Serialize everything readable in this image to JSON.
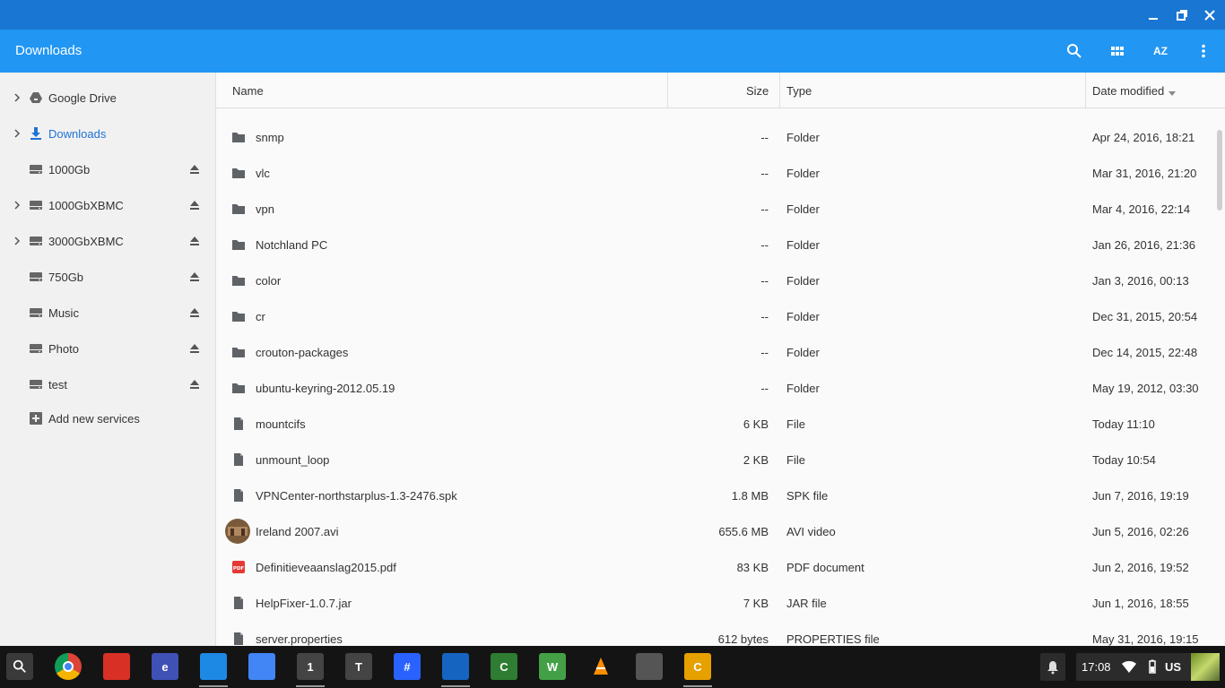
{
  "window": {
    "controls": [
      "minimize-icon",
      "restore-icon",
      "close-icon"
    ]
  },
  "header": {
    "title": "Downloads",
    "sort_label": "AZ",
    "actions": [
      "search-icon",
      "grid-view-icon",
      "sort-icon",
      "more-icon"
    ]
  },
  "sidebar": {
    "items": [
      {
        "label": "Google Drive",
        "icon": "drive-icon",
        "expandable": true,
        "eject": false
      },
      {
        "label": "Downloads",
        "icon": "download-icon",
        "expandable": true,
        "eject": false,
        "active": true
      },
      {
        "label": "1000Gb",
        "icon": "drive-disk-icon",
        "expandable": false,
        "eject": true
      },
      {
        "label": "1000GbXBMC",
        "icon": "drive-disk-icon",
        "expandable": true,
        "eject": true
      },
      {
        "label": "3000GbXBMC",
        "icon": "drive-disk-icon",
        "expandable": true,
        "eject": true
      },
      {
        "label": "750Gb",
        "icon": "drive-disk-icon",
        "expandable": false,
        "eject": true
      },
      {
        "label": "Music",
        "icon": "drive-disk-icon",
        "expandable": false,
        "eject": true
      },
      {
        "label": "Photo",
        "icon": "drive-disk-icon",
        "expandable": false,
        "eject": true
      },
      {
        "label": "test",
        "icon": "drive-disk-icon",
        "expandable": false,
        "eject": true
      }
    ],
    "add_services": "Add new services"
  },
  "columns": {
    "name": "Name",
    "size": "Size",
    "type": "Type",
    "date": "Date modified"
  },
  "files": [
    {
      "name": "snmp",
      "size": "--",
      "type": "Folder",
      "date": "Apr 24, 2016, 18:21",
      "icon": "folder-icon"
    },
    {
      "name": "vlc",
      "size": "--",
      "type": "Folder",
      "date": "Mar 31, 2016, 21:20",
      "icon": "folder-icon"
    },
    {
      "name": "vpn",
      "size": "--",
      "type": "Folder",
      "date": "Mar 4, 2016, 22:14",
      "icon": "folder-icon"
    },
    {
      "name": "Notchland PC",
      "size": "--",
      "type": "Folder",
      "date": "Jan 26, 2016, 21:36",
      "icon": "folder-icon"
    },
    {
      "name": "color",
      "size": "--",
      "type": "Folder",
      "date": "Jan 3, 2016, 00:13",
      "icon": "folder-icon"
    },
    {
      "name": "cr",
      "size": "--",
      "type": "Folder",
      "date": "Dec 31, 2015, 20:54",
      "icon": "folder-icon"
    },
    {
      "name": "crouton-packages",
      "size": "--",
      "type": "Folder",
      "date": "Dec 14, 2015, 22:48",
      "icon": "folder-icon"
    },
    {
      "name": "ubuntu-keyring-2012.05.19",
      "size": "--",
      "type": "Folder",
      "date": "May 19, 2012, 03:30",
      "icon": "folder-icon"
    },
    {
      "name": "mountcifs",
      "size": "6 KB",
      "type": "File",
      "date": "Today 11:10",
      "icon": "file-icon"
    },
    {
      "name": "unmount_loop",
      "size": "2 KB",
      "type": "File",
      "date": "Today 10:54",
      "icon": "file-icon"
    },
    {
      "name": "VPNCenter-northstarplus-1.3-2476.spk",
      "size": "1.8 MB",
      "type": "SPK file",
      "date": "Jun 7, 2016, 19:19",
      "icon": "file-icon"
    },
    {
      "name": "Ireland 2007.avi",
      "size": "655.6 MB",
      "type": "AVI video",
      "date": "Jun 5, 2016, 02:26",
      "icon": "video-thumbnail-icon"
    },
    {
      "name": "Definitieveaanslag2015.pdf",
      "size": "83 KB",
      "type": "PDF document",
      "date": "Jun 2, 2016, 19:52",
      "icon": "pdf-icon"
    },
    {
      "name": "HelpFixer-1.0.7.jar",
      "size": "7 KB",
      "type": "JAR file",
      "date": "Jun 1, 2016, 18:55",
      "icon": "file-icon"
    },
    {
      "name": "server.properties",
      "size": "612 bytes",
      "type": "PROPERTIES file",
      "date": "May 31, 2016, 19:15",
      "icon": "file-icon"
    }
  ],
  "shelf": {
    "apps": [
      {
        "name": "chrome",
        "icon": "chrome-icon",
        "color": "#4caf50",
        "glyph": ""
      },
      {
        "name": "gmail",
        "icon": "gmail-icon",
        "color": "#d93025",
        "glyph": ""
      },
      {
        "name": "text-editor",
        "icon": "editor-icon",
        "color": "#3f51b5",
        "glyph": "e"
      },
      {
        "name": "files",
        "icon": "files-icon",
        "color": "#1e88e5",
        "glyph": "",
        "open": true
      },
      {
        "name": "docs",
        "icon": "docs-icon",
        "color": "#4285f4",
        "glyph": ""
      },
      {
        "name": "terminal-1",
        "icon": "terminal-icon",
        "color": "#444444",
        "glyph": "1",
        "open": true
      },
      {
        "name": "terminal-t",
        "icon": "terminal-icon",
        "color": "#444444",
        "glyph": "T"
      },
      {
        "name": "hashtag-chat",
        "icon": "chat-icon",
        "color": "#2962ff",
        "glyph": "#"
      },
      {
        "name": "bird-app",
        "icon": "bird-icon",
        "color": "#1565c0",
        "glyph": "",
        "open": true
      },
      {
        "name": "crosh",
        "icon": "crosh-icon",
        "color": "#2e7d32",
        "glyph": "C"
      },
      {
        "name": "writer",
        "icon": "writer-icon",
        "color": "#43a047",
        "glyph": "W"
      },
      {
        "name": "vlc",
        "icon": "vlc-icon",
        "color": "#ff8f00",
        "glyph": ""
      },
      {
        "name": "webcam",
        "icon": "webcam-icon",
        "color": "#555555",
        "glyph": ""
      },
      {
        "name": "c-app",
        "icon": "c-icon",
        "color": "#e6a100",
        "glyph": "C",
        "open": true
      }
    ],
    "time": "17:08",
    "keyboard": "US"
  }
}
